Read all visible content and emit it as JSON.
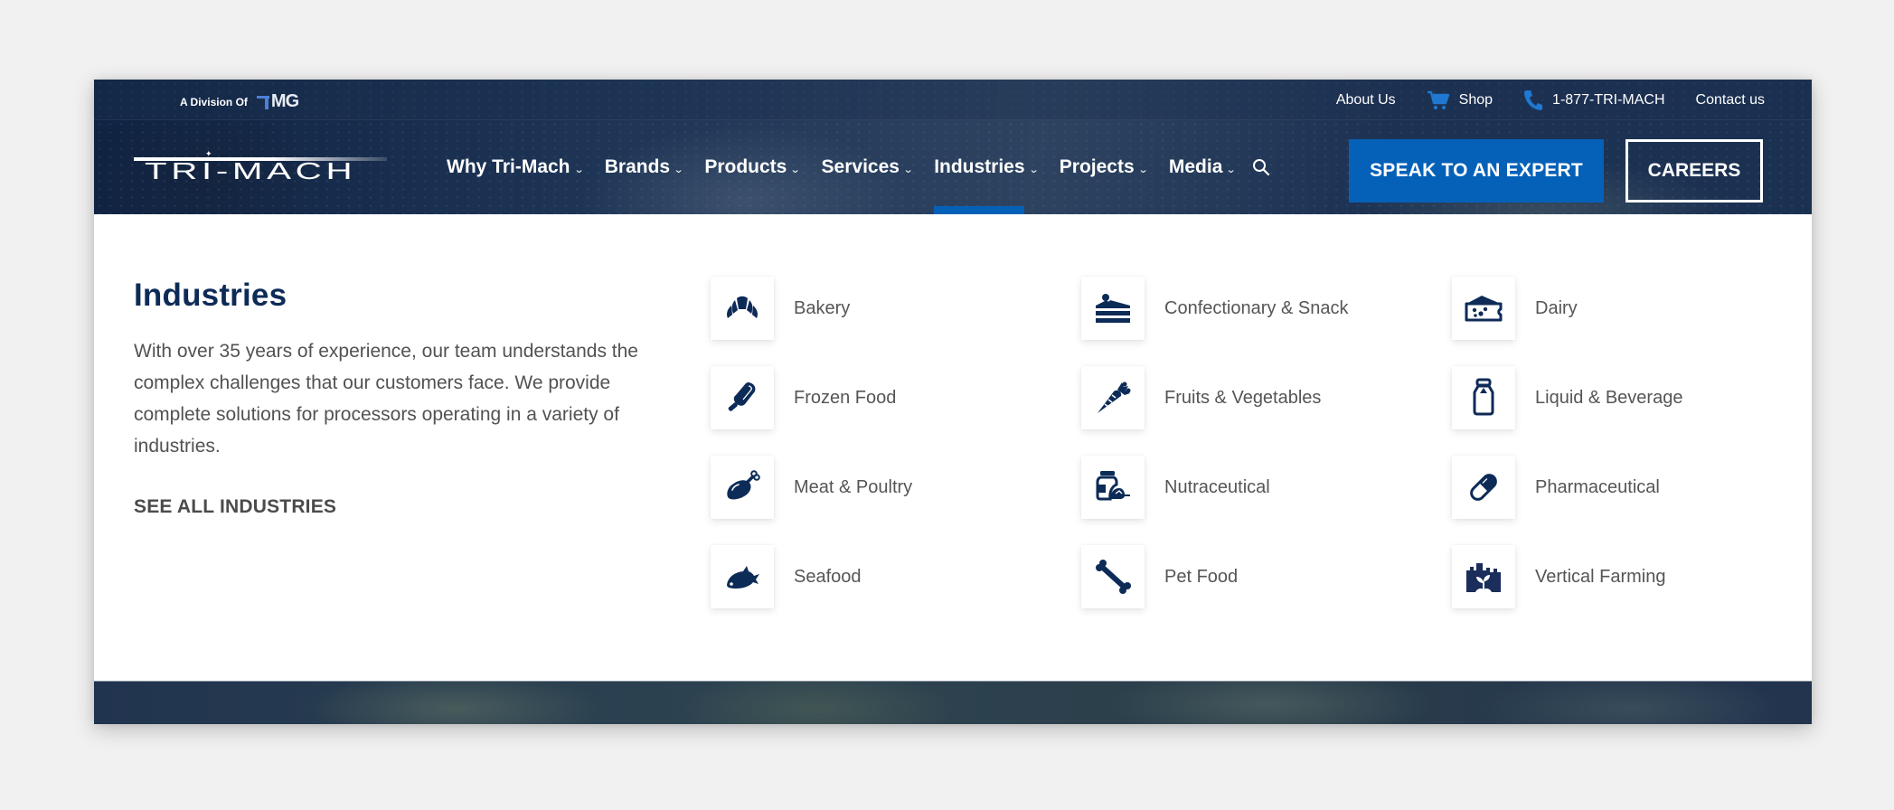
{
  "topbar": {
    "division_label": "A Division Of",
    "division_brand": "MG",
    "links": [
      {
        "label": "About Us",
        "icon": ""
      },
      {
        "label": "Shop",
        "icon": "cart-icon"
      },
      {
        "label": "1-877-TRI-MACH",
        "icon": "phone-icon"
      },
      {
        "label": "Contact us",
        "icon": ""
      }
    ]
  },
  "header": {
    "logo_text": "TRI-MACH",
    "nav": [
      {
        "label": "Why Tri-Mach",
        "chevron": "⌄",
        "active": false
      },
      {
        "label": "Brands",
        "chevron": "⌄",
        "active": false
      },
      {
        "label": "Products",
        "chevron": "⌄",
        "active": false
      },
      {
        "label": "Services",
        "chevron": "⌄",
        "active": false
      },
      {
        "label": "Industries",
        "chevron": "⌄",
        "active": true
      },
      {
        "label": "Projects",
        "chevron": "⌄",
        "active": false
      },
      {
        "label": "Media",
        "chevron": "⌄",
        "active": false
      }
    ],
    "search_icon": "search-icon",
    "cta_label": "SPEAK TO AN EXPERT",
    "careers_label": "CAREERS"
  },
  "panel": {
    "title": "Industries",
    "description": "With over 35 years of experience, our team understands the complex challenges that our customers face. We provide complete solutions for processors operating in a variety of industries.",
    "see_all_label": "SEE ALL INDUSTRIES",
    "industries": [
      {
        "label": "Bakery",
        "icon": "croissant-icon"
      },
      {
        "label": "Confectionary & Snack",
        "icon": "cake-slice-icon"
      },
      {
        "label": "Dairy",
        "icon": "cheese-icon"
      },
      {
        "label": "Frozen Food",
        "icon": "popsicle-icon"
      },
      {
        "label": "Fruits & Vegetables",
        "icon": "carrot-icon"
      },
      {
        "label": "Liquid & Beverage",
        "icon": "milk-bottle-icon"
      },
      {
        "label": "Meat & Poultry",
        "icon": "drumstick-icon"
      },
      {
        "label": "Nutraceutical",
        "icon": "supplement-jar-icon"
      },
      {
        "label": "Pharmaceutical",
        "icon": "capsule-icon"
      },
      {
        "label": "Seafood",
        "icon": "fish-icon"
      },
      {
        "label": "Pet Food",
        "icon": "bone-icon"
      },
      {
        "label": "Vertical Farming",
        "icon": "vertical-farm-icon"
      }
    ]
  },
  "colors": {
    "brand_navy": "#0d2b57",
    "accent_blue": "#0561b8",
    "icon_color": "#0d2b57",
    "body_text": "#555555"
  }
}
